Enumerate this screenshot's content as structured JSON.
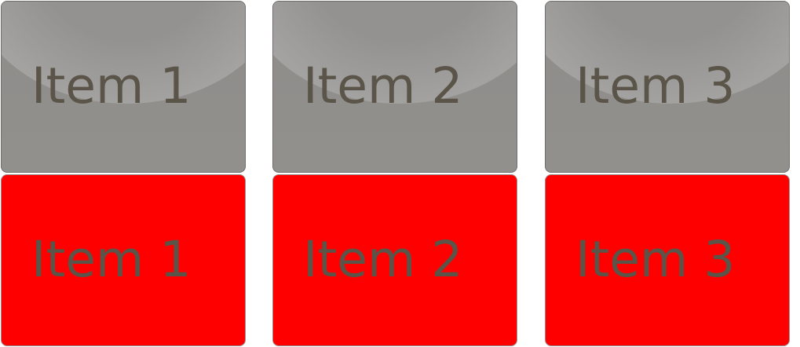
{
  "top_row": [
    {
      "label": "Item 1"
    },
    {
      "label": "Item 2"
    },
    {
      "label": "Item 3"
    }
  ],
  "bottom_row": [
    {
      "label": "Item 1"
    },
    {
      "label": "Item 2"
    },
    {
      "label": "Item 3"
    }
  ],
  "colors": {
    "top_tile": "#908f8c",
    "bottom_tile": "#ff0000",
    "text": "#5a5449"
  }
}
